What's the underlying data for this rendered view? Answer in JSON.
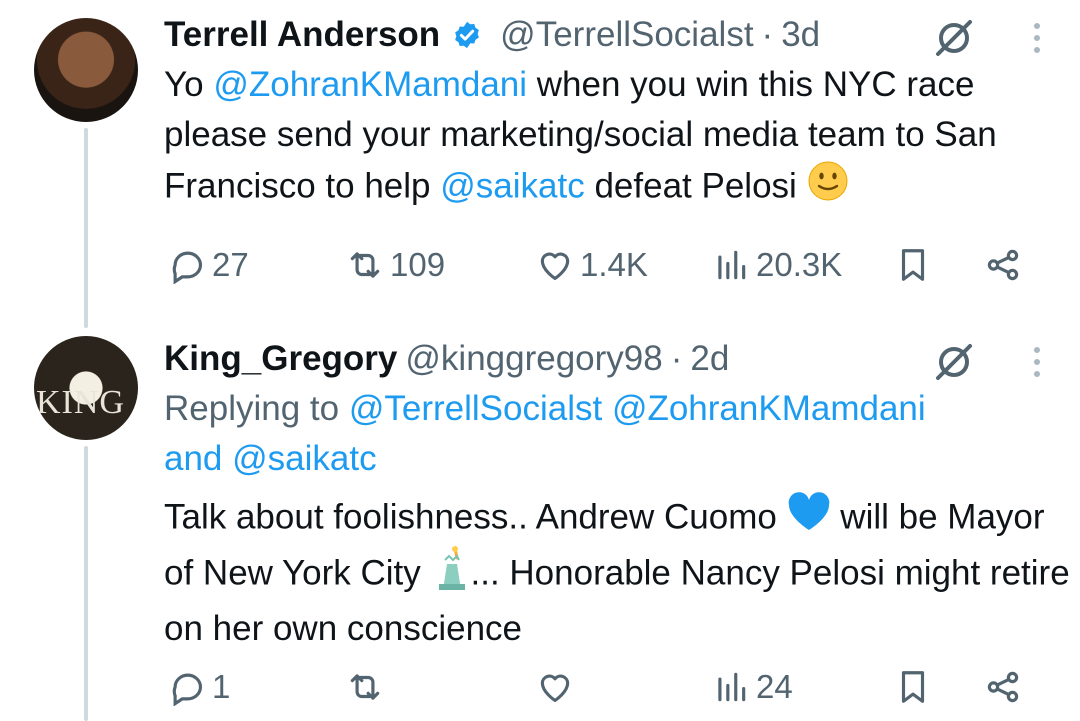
{
  "tweets": [
    {
      "name": "Terrell Anderson",
      "handle": "@TerrellSocialst",
      "age": "3d",
      "body": {
        "p1": "Yo ",
        "m1": "@ZohranKMamdani",
        "p2": " when you win this NYC race please send your marketing/social media team to San Francisco to help ",
        "m2": "@saikatc",
        "p3": " defeat Pelosi"
      },
      "stats": {
        "replies": "27",
        "reposts": "109",
        "likes": "1.4K",
        "views": "20.3K"
      }
    },
    {
      "name": "King_Gregory",
      "handle": "@kinggregory98",
      "age": "2d",
      "avatar_text": "KING",
      "replying": {
        "prefix": "Replying to ",
        "m1": "@TerrellSocialst",
        "m2": "@ZohranKMamdani",
        "m3": "and @saikatc"
      },
      "body": {
        "p1": "Talk about foolishness.. Andrew Cuomo ",
        "p2": " will be Mayor of New York City ",
        "p3": "... Honorable Nancy Pelosi might retire on her own conscience"
      },
      "stats": {
        "replies": "1",
        "reposts": "",
        "likes": "",
        "views": "24"
      }
    }
  ],
  "colors": {
    "link": "#1d9bf0",
    "muted": "#536471",
    "verified": "#1d9bf0",
    "text": "#0f1419"
  }
}
